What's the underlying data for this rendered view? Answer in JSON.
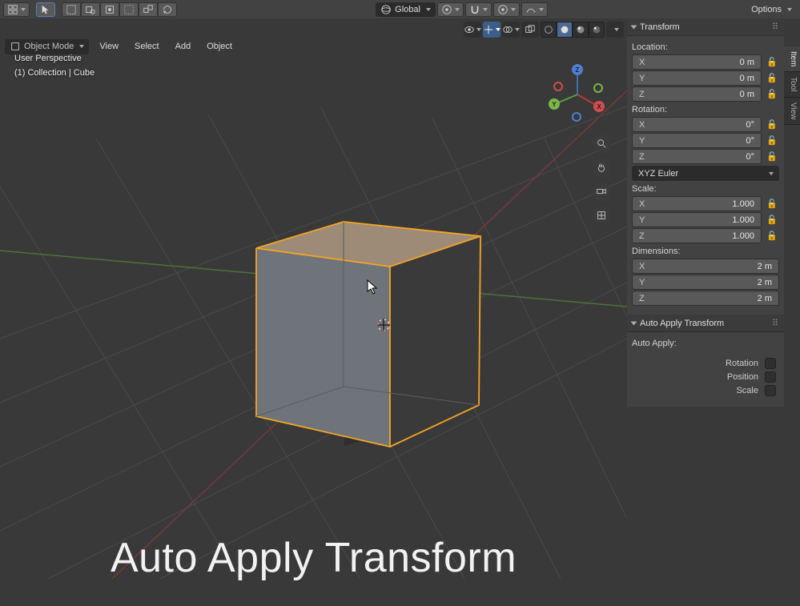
{
  "header": {
    "orientation": "Global",
    "options": "Options"
  },
  "mode": {
    "label": "Object Mode",
    "menus": [
      "View",
      "Select",
      "Add",
      "Object"
    ]
  },
  "overlay": {
    "line1": "User Perspective",
    "line2": "(1) Collection | Cube"
  },
  "sideTabs": [
    "Item",
    "Tool",
    "View"
  ],
  "transform": {
    "title": "Transform",
    "location": {
      "label": "Location:",
      "x": "0 m",
      "y": "0 m",
      "z": "0 m"
    },
    "rotation": {
      "label": "Rotation:",
      "x": "0°",
      "y": "0°",
      "z": "0°",
      "mode": "XYZ Euler"
    },
    "scale": {
      "label": "Scale:",
      "x": "1.000",
      "y": "1.000",
      "z": "1.000"
    },
    "dimensions": {
      "label": "Dimensions:",
      "x": "2 m",
      "y": "2 m",
      "z": "2 m"
    },
    "axes": {
      "x": "X",
      "y": "Y",
      "z": "Z"
    }
  },
  "autoApply": {
    "title": "Auto Apply Transform",
    "label": "Auto Apply:",
    "opts": [
      "Rotation",
      "Position",
      "Scale"
    ]
  },
  "bigTitle": "Auto Apply Transform"
}
